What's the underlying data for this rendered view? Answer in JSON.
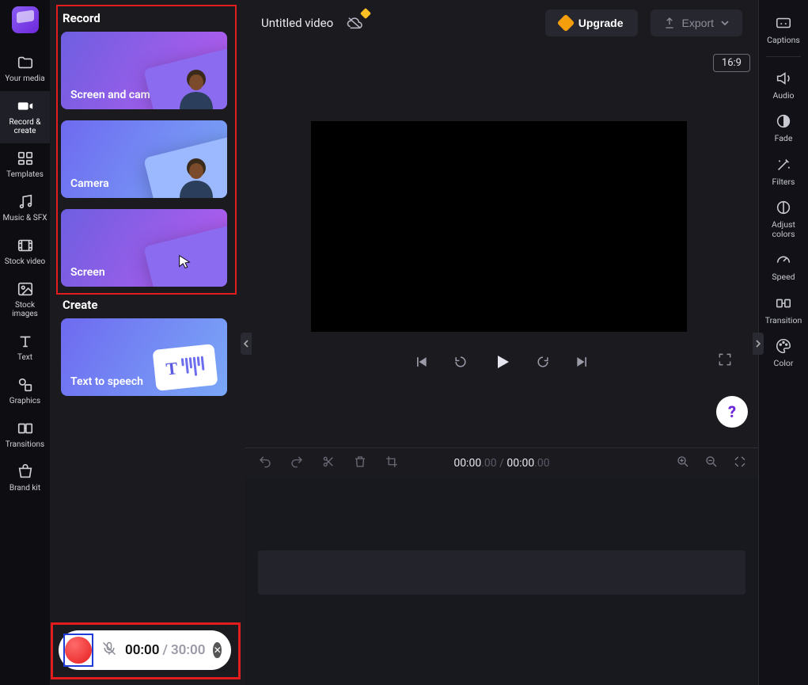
{
  "left_nav": {
    "your_media": "Your media",
    "record_create": "Record & create",
    "templates": "Templates",
    "music_sfx": "Music & SFX",
    "stock_video": "Stock video",
    "stock_images": "Stock images",
    "text": "Text",
    "graphics": "Graphics",
    "transitions": "Transitions",
    "brand_kit": "Brand kit"
  },
  "panel": {
    "record_heading": "Record",
    "create_heading": "Create",
    "cards": {
      "screen_camera": "Screen and camera",
      "camera": "Camera",
      "screen": "Screen",
      "tts": "Text to speech"
    }
  },
  "topbar": {
    "title": "Untitled video",
    "upgrade": "Upgrade",
    "export": "Export",
    "aspect": "16:9"
  },
  "right_props": {
    "captions": "Captions",
    "audio": "Audio",
    "fade": "Fade",
    "filters": "Filters",
    "adjust_colors": "Adjust colors",
    "speed": "Speed",
    "transition": "Transition",
    "color": "Color"
  },
  "timeline": {
    "current_main": "00:00",
    "current_sub": ".00",
    "separator": " / ",
    "total_main": "00:00",
    "total_sub": ".00"
  },
  "record_pill": {
    "current": "00:00",
    "separator": " / ",
    "max": "30:00"
  },
  "help": "?"
}
